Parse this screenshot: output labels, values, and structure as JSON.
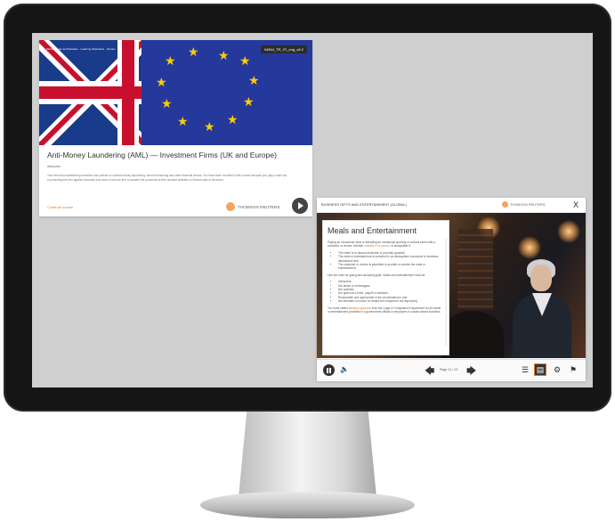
{
  "course": {
    "banner_meta": "Module Code and Duration · Learning Objectives · Version",
    "code_badge": "04954_TR_ITI_eng_v8.2",
    "title": "Anti-Money Laundering (AML) — Investment Firms (UK and Europe)",
    "welcome": "Welcome",
    "description": "Your firm has established processes and policies to combat money laundering, terrorist financing and other financial crimes. You have been enrolled in this course because you play a vital role in protecting the firm against criminals who seek to use the firm to launder the proceeds of their criminal activities or finance acts of terrorism.",
    "start_link": "Continue course",
    "logo_text": "THOMSON REUTERS",
    "play_label": "Play"
  },
  "player": {
    "title": "BUSINESS GIFTS AND ENTERTAINMENT (GLOBAL)",
    "logo_text": "THOMSON REUTERS",
    "close_label": "X",
    "content_title": "Meals and Entertainment",
    "intro": "Paying an occasional meal or attending an occasional sporting or cultural event with a customer or vendor, whether virtually or in person, is acceptable if:",
    "intro_highlight": "virtually or in person",
    "conditions": [
      "The intent is to discuss business or promote goodwill.",
      "The meal or entertainment is furnished in an atmosphere conducive to business discussions and",
      "The customer or vendor is permitted to provide or receive the meal or entertainment."
    ],
    "guidance_intro": "Like the rules for giving and accepting gifts, meals and entertainment must be:",
    "guidance": [
      "Infrequent.",
      "Not lavish or extravagant.",
      "Not solicited.",
      "Not given as a bribe, payoff or kickback.",
      "Reasonable and appropriate in the circumstances; and",
      "Not intended to induce or reward the recipient to act improperly."
    ],
    "footer_text": "You must obtain advance approval from the Legal or Compliance Department for all meals or entertainment provided to a government official or employee of a state-owned business.",
    "footer_highlight": "advance approval",
    "page_indicator": "Page 11 / 13",
    "controls": {
      "pause": "Pause",
      "volume": "🔈",
      "prev": "🡄",
      "next": "🡆",
      "list": "☰",
      "notes": "▤",
      "settings": "⚙",
      "glossary": "⚑"
    }
  },
  "colors": {
    "accent": "#e87722",
    "eu_blue": "#24399b",
    "star": "#ffcc00"
  }
}
